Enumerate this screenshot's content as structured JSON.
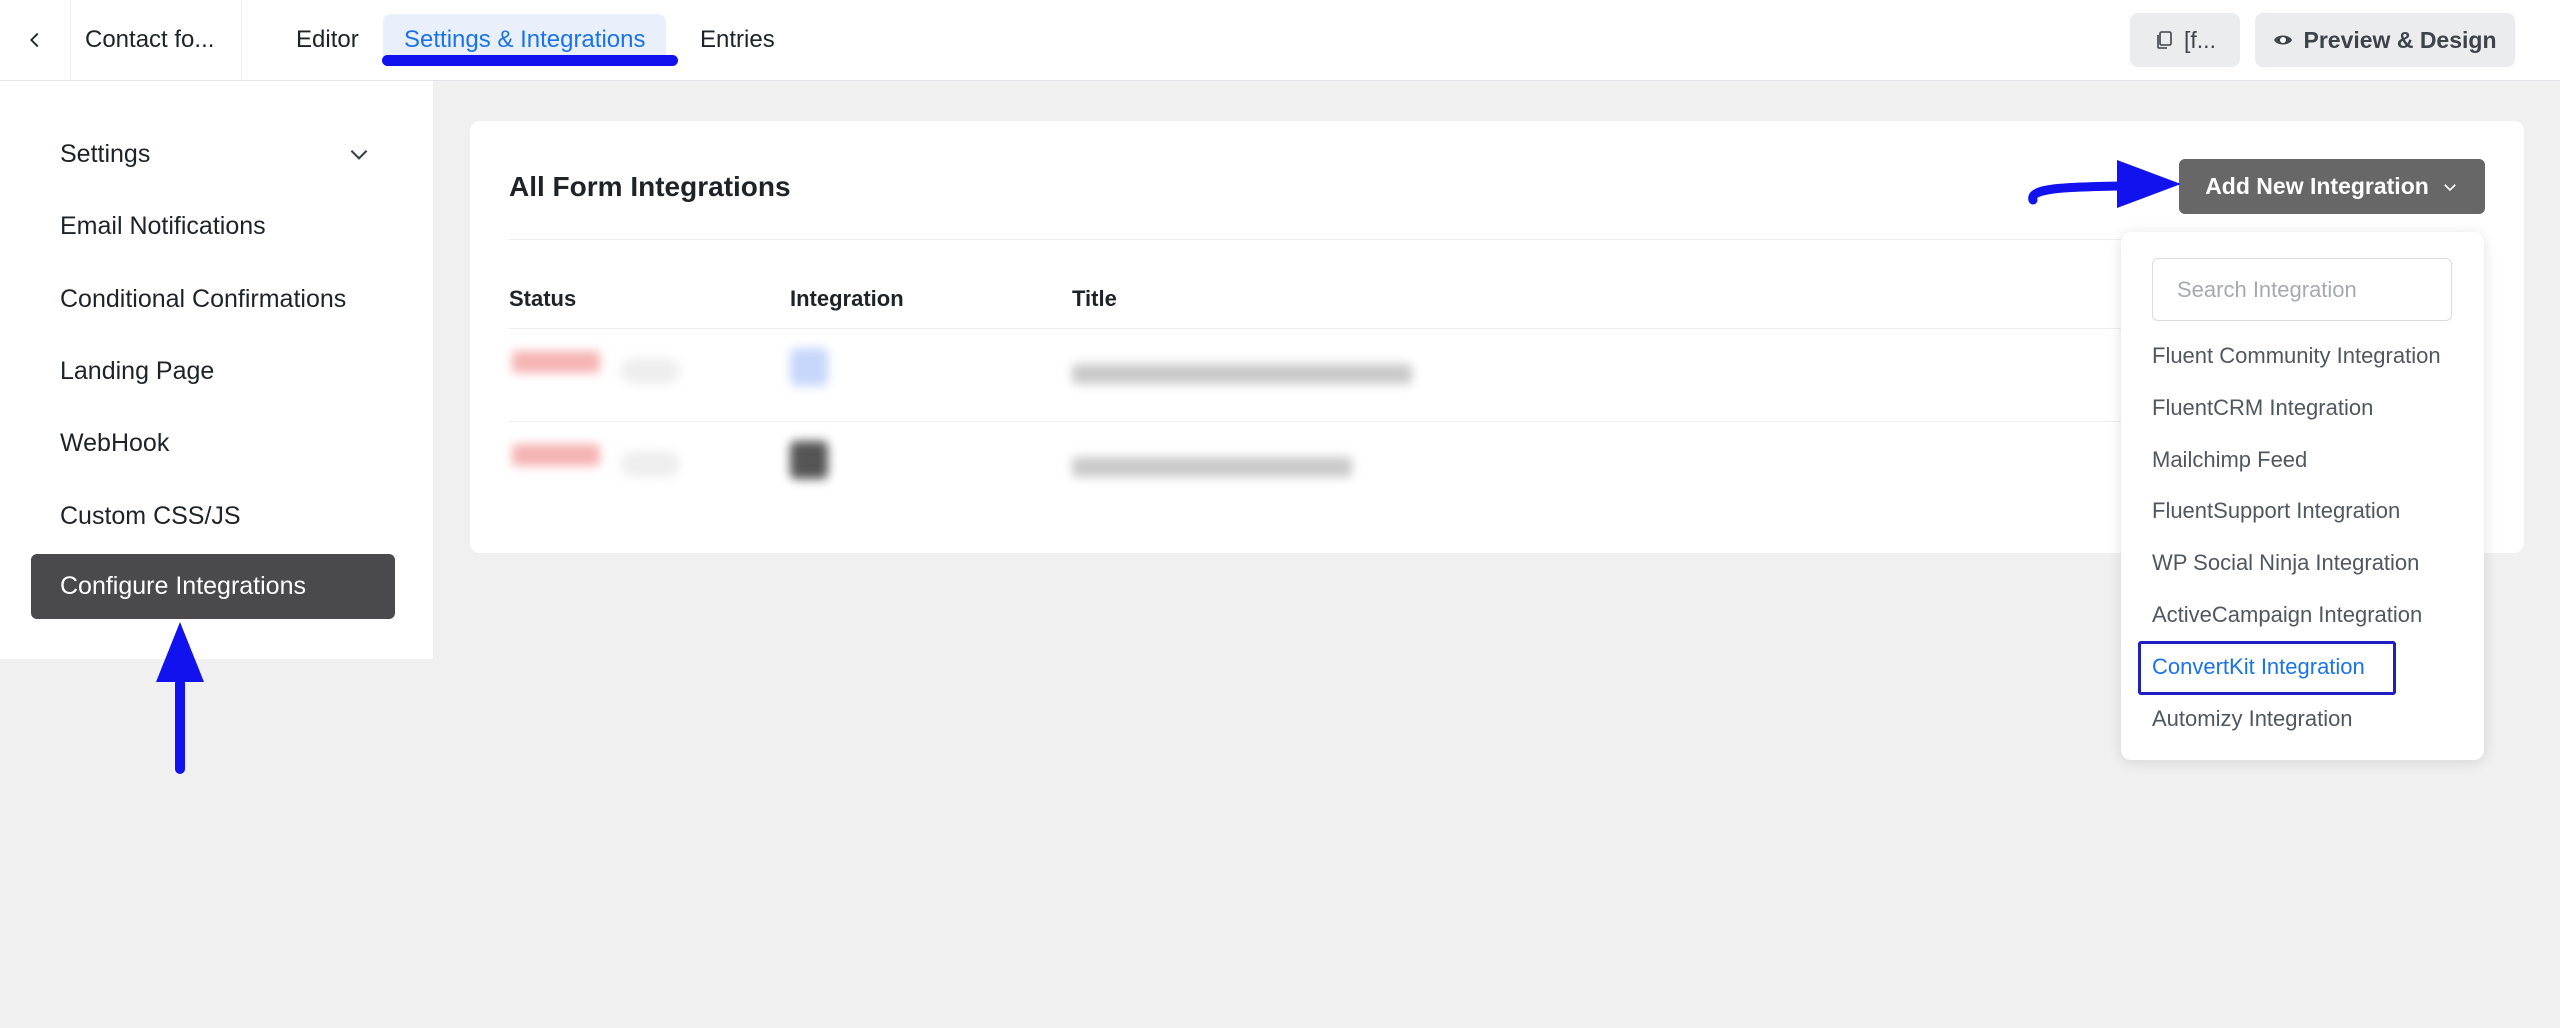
{
  "topbar": {
    "back_icon": "chevron-left-icon",
    "form_name": "Contact fo...",
    "tabs": [
      {
        "label": "Editor",
        "active": false
      },
      {
        "label": "Settings & Integrations",
        "active": true
      },
      {
        "label": "Entries",
        "active": false
      }
    ],
    "shortcode_label": "[f...",
    "shortcode_icon": "copy-icon",
    "preview_label": "Preview & Design",
    "preview_icon": "eye-icon"
  },
  "sidebar": {
    "items": [
      {
        "label": "Settings",
        "icon": "chevron-down-icon"
      },
      {
        "label": "Email Notifications"
      },
      {
        "label": "Conditional Confirmations"
      },
      {
        "label": "Landing Page"
      },
      {
        "label": "WebHook"
      },
      {
        "label": "Custom CSS/JS"
      },
      {
        "label": "Configure Integrations",
        "active": true
      }
    ]
  },
  "main": {
    "title": "All Form Integrations",
    "add_button_label": "Add New Integration",
    "columns": [
      "Status",
      "Integration",
      "Title"
    ],
    "rows_blurred": 2
  },
  "dropdown": {
    "search_placeholder": "Search Integration",
    "items": [
      "Fluent Community Integration",
      "FluentCRM Integration",
      "Mailchimp Feed",
      "FluentSupport Integration",
      "WP Social Ninja Integration",
      "ActiveCampaign Integration",
      "ConvertKit Integration",
      "Automizy Integration"
    ],
    "selected": "ConvertKit Integration"
  },
  "colors": {
    "accent": "#1a73e8",
    "annotation": "#1212ee",
    "active_sidebar_bg": "#4a4a4c",
    "add_button_bg": "#676767"
  }
}
